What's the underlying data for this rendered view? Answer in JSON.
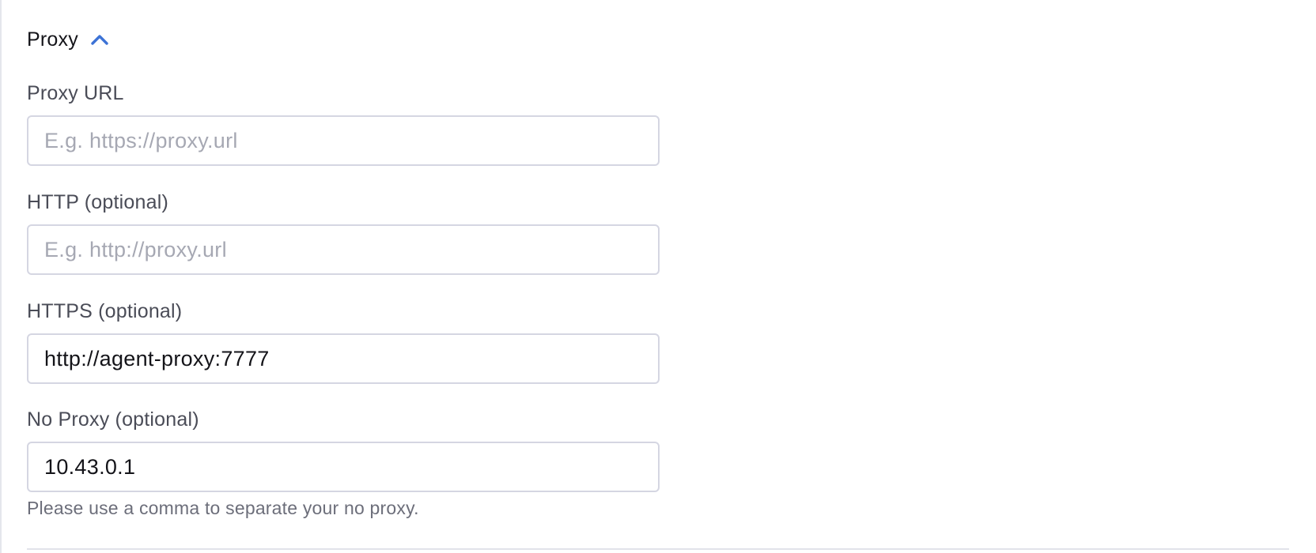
{
  "section": {
    "title": "Proxy",
    "toggle_icon": "chevron-up-icon",
    "accent_color": "#3d73d6"
  },
  "fields": {
    "proxy_url": {
      "label": "Proxy URL",
      "value": "",
      "placeholder": "E.g. https://proxy.url"
    },
    "http": {
      "label": "HTTP (optional)",
      "value": "",
      "placeholder": "E.g. http://proxy.url"
    },
    "https": {
      "label": "HTTPS (optional)",
      "value": "http://agent-proxy:7777",
      "placeholder": ""
    },
    "no_proxy": {
      "label": "No Proxy (optional)",
      "value": "10.43.0.1",
      "placeholder": "",
      "help": "Please use a comma to separate your no proxy."
    }
  }
}
